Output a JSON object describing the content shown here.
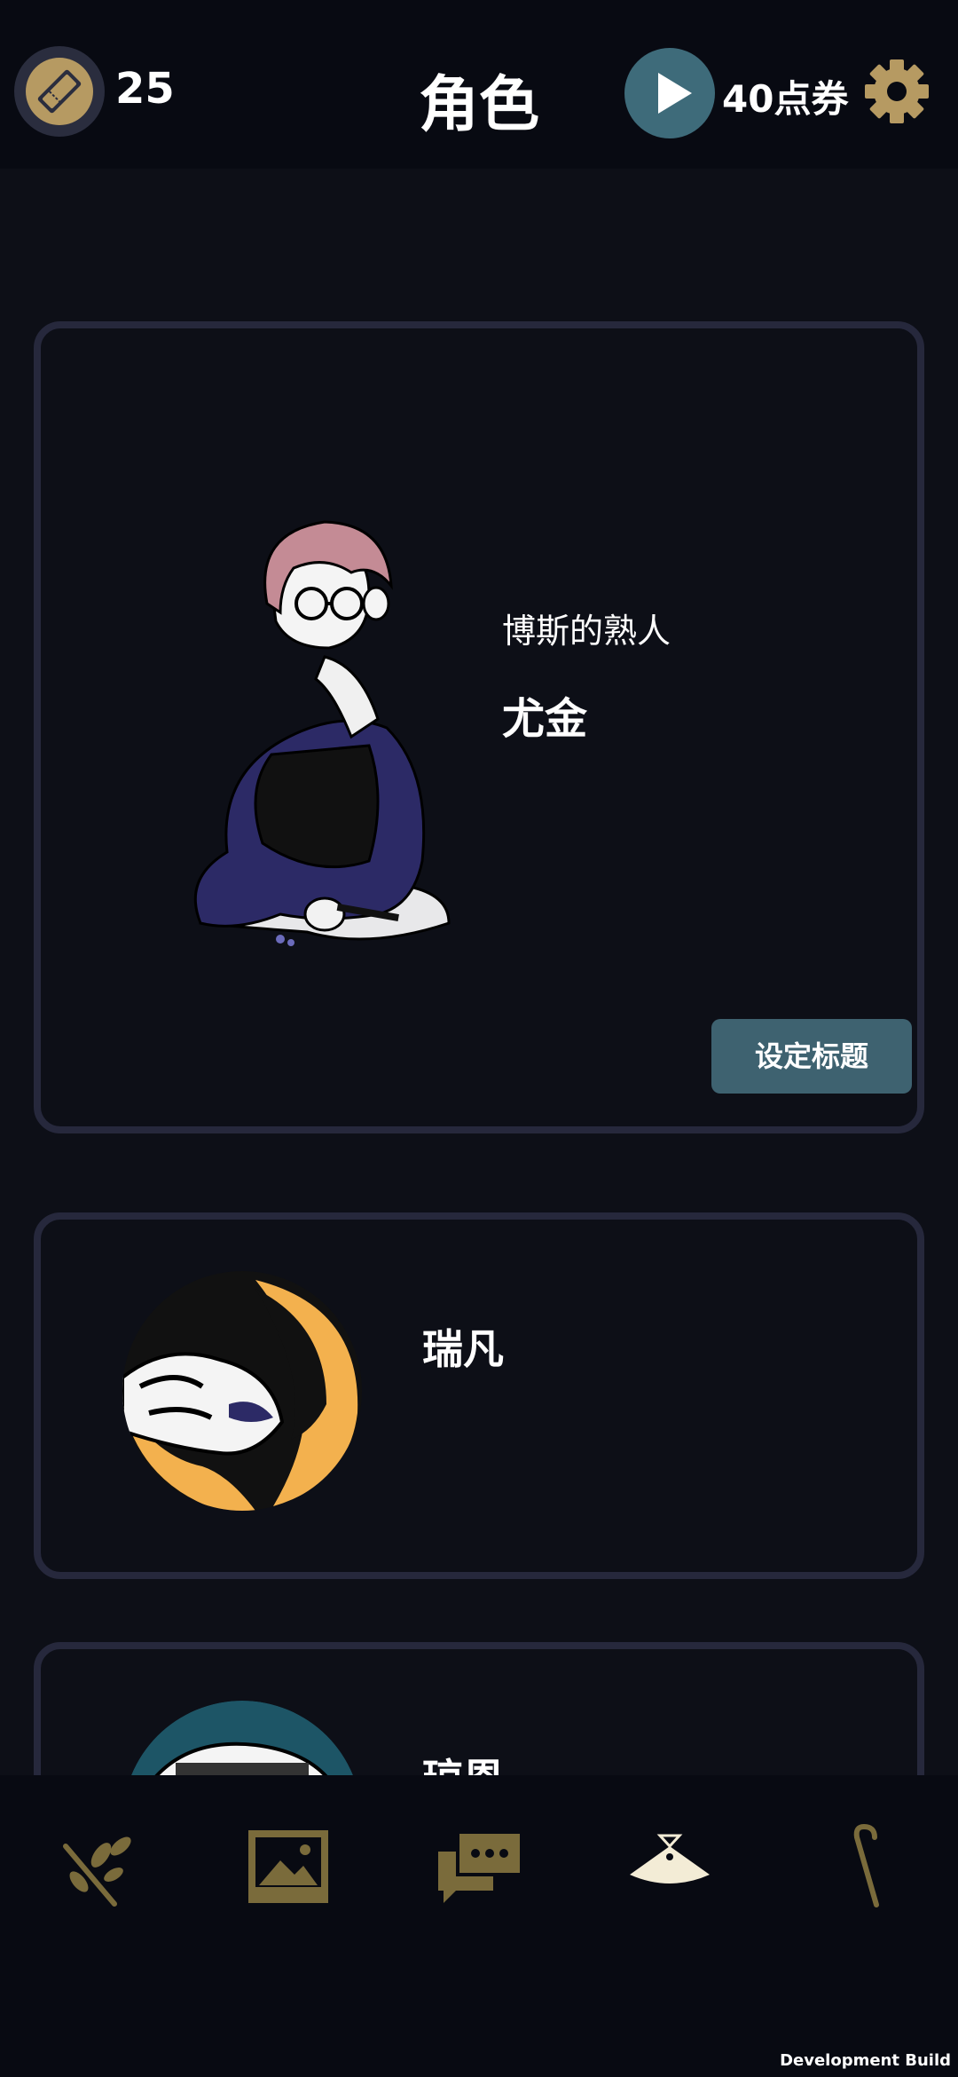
{
  "header": {
    "title": "角色",
    "ticket_count": "25",
    "voucher_label": "40点券"
  },
  "characters": [
    {
      "subtitle": "博斯的熟人",
      "name": "尤金",
      "action_label": "设定标题"
    },
    {
      "name": "瑞凡"
    },
    {
      "name": "琼恩"
    }
  ],
  "bottom_nav": {
    "items": [
      "branch-icon",
      "gallery-icon",
      "chat-icon",
      "character-icon",
      "cane-icon"
    ]
  },
  "footer": {
    "build_label": "Development Build"
  },
  "colors": {
    "accent_gold": "#b69a62",
    "play_teal": "#3e6b7a",
    "card_border": "#26283c",
    "button": "#3e6270"
  }
}
